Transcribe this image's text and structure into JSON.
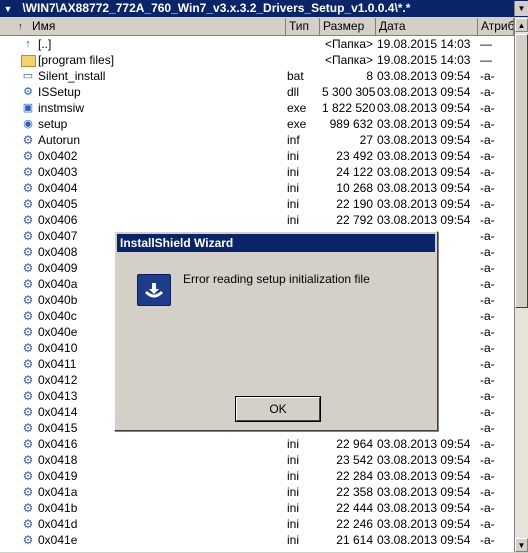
{
  "pathbar": {
    "drive_arrow": "▼",
    "path": "\\WIN7\\AX88772_772A_760_Win7_v3.x.3.2_Drivers_Setup_v1.0.0.4\\*.*"
  },
  "header": {
    "name": "Имя",
    "ext": "Тип",
    "size": "Размер",
    "date": "Дата",
    "attr": "Атрибут"
  },
  "files": [
    {
      "icon": "up-icon",
      "name": "[..]",
      "ext": "",
      "size": "<Папка>",
      "date": "19.08.2015 14:03",
      "attr": "—"
    },
    {
      "icon": "folder-icon",
      "name": "[program files]",
      "ext": "",
      "size": "<Папка>",
      "date": "19.08.2015 14:03",
      "attr": "—"
    },
    {
      "icon": "file-icon",
      "name": "Silent_install",
      "ext": "bat",
      "size": "8",
      "date": "03.08.2013 09:54",
      "attr": "-a-"
    },
    {
      "icon": "app-icon",
      "name": "ISSetup",
      "ext": "dll",
      "size": "5 300 305",
      "date": "03.08.2013 09:54",
      "attr": "-a-"
    },
    {
      "icon": "installer-icon",
      "name": "instmsiw",
      "ext": "exe",
      "size": "1 822 520",
      "date": "03.08.2013 09:54",
      "attr": "-a-"
    },
    {
      "icon": "setup-icon",
      "name": "setup",
      "ext": "exe",
      "size": "989 632",
      "date": "03.08.2013 09:54",
      "attr": "-a-"
    },
    {
      "icon": "gear-icon",
      "name": "Autorun",
      "ext": "inf",
      "size": "27",
      "date": "03.08.2013 09:54",
      "attr": "-a-"
    },
    {
      "icon": "gear-icon",
      "name": "0x0402",
      "ext": "ini",
      "size": "23 492",
      "date": "03.08.2013 09:54",
      "attr": "-a-"
    },
    {
      "icon": "gear-icon",
      "name": "0x0403",
      "ext": "ini",
      "size": "24 122",
      "date": "03.08.2013 09:54",
      "attr": "-a-"
    },
    {
      "icon": "gear-icon",
      "name": "0x0404",
      "ext": "ini",
      "size": "10 268",
      "date": "03.08.2013 09:54",
      "attr": "-a-"
    },
    {
      "icon": "gear-icon",
      "name": "0x0405",
      "ext": "ini",
      "size": "22 190",
      "date": "03.08.2013 09:54",
      "attr": "-a-"
    },
    {
      "icon": "gear-icon",
      "name": "0x0406",
      "ext": "ini",
      "size": "22 792",
      "date": "03.08.2013 09:54",
      "attr": "-a-"
    },
    {
      "icon": "gear-icon",
      "name": "0x0407",
      "ext": "",
      "size": "",
      "date": "",
      "attr": "-a-"
    },
    {
      "icon": "gear-icon",
      "name": "0x0408",
      "ext": "",
      "size": "",
      "date": "",
      "attr": "-a-"
    },
    {
      "icon": "gear-icon",
      "name": "0x0409",
      "ext": "",
      "size": "",
      "date": "",
      "attr": "-a-"
    },
    {
      "icon": "gear-icon",
      "name": "0x040a",
      "ext": "",
      "size": "",
      "date": "",
      "attr": "-a-"
    },
    {
      "icon": "gear-icon",
      "name": "0x040b",
      "ext": "",
      "size": "",
      "date": "",
      "attr": "-a-"
    },
    {
      "icon": "gear-icon",
      "name": "0x040c",
      "ext": "",
      "size": "",
      "date": "",
      "attr": "-a-"
    },
    {
      "icon": "gear-icon",
      "name": "0x040e",
      "ext": "",
      "size": "",
      "date": "",
      "attr": "-a-"
    },
    {
      "icon": "gear-icon",
      "name": "0x0410",
      "ext": "",
      "size": "",
      "date": "",
      "attr": "-a-"
    },
    {
      "icon": "gear-icon",
      "name": "0x0411",
      "ext": "",
      "size": "",
      "date": "",
      "attr": "-a-"
    },
    {
      "icon": "gear-icon",
      "name": "0x0412",
      "ext": "",
      "size": "",
      "date": "",
      "attr": "-a-"
    },
    {
      "icon": "gear-icon",
      "name": "0x0413",
      "ext": "",
      "size": "",
      "date": "",
      "attr": "-a-"
    },
    {
      "icon": "gear-icon",
      "name": "0x0414",
      "ext": "",
      "size": "",
      "date": "",
      "attr": "-a-"
    },
    {
      "icon": "gear-icon",
      "name": "0x0415",
      "ext": "",
      "size": "",
      "date": "",
      "attr": "-a-"
    },
    {
      "icon": "gear-icon",
      "name": "0x0416",
      "ext": "ini",
      "size": "22 964",
      "date": "03.08.2013 09:54",
      "attr": "-a-"
    },
    {
      "icon": "gear-icon",
      "name": "0x0418",
      "ext": "ini",
      "size": "23 542",
      "date": "03.08.2013 09:54",
      "attr": "-a-"
    },
    {
      "icon": "gear-icon",
      "name": "0x0419",
      "ext": "ini",
      "size": "22 284",
      "date": "03.08.2013 09:54",
      "attr": "-a-"
    },
    {
      "icon": "gear-icon",
      "name": "0x041a",
      "ext": "ini",
      "size": "22 358",
      "date": "03.08.2013 09:54",
      "attr": "-a-"
    },
    {
      "icon": "gear-icon",
      "name": "0x041b",
      "ext": "ini",
      "size": "22 444",
      "date": "03.08.2013 09:54",
      "attr": "-a-"
    },
    {
      "icon": "gear-icon",
      "name": "0x041d",
      "ext": "ini",
      "size": "22 246",
      "date": "03.08.2013 09:54",
      "attr": "-a-"
    },
    {
      "icon": "gear-icon",
      "name": "0x041e",
      "ext": "ini",
      "size": "21 614",
      "date": "03.08.2013 09:54",
      "attr": "-a-"
    }
  ],
  "dialog": {
    "title": "InstallShield Wizard",
    "message": "Error reading setup initialization file",
    "ok_label": "OK",
    "icon": "installshield-icon"
  },
  "colors": {
    "titlebar": "#0a246a",
    "window": "#d4d0c8",
    "list_bg": "#ffffff"
  }
}
